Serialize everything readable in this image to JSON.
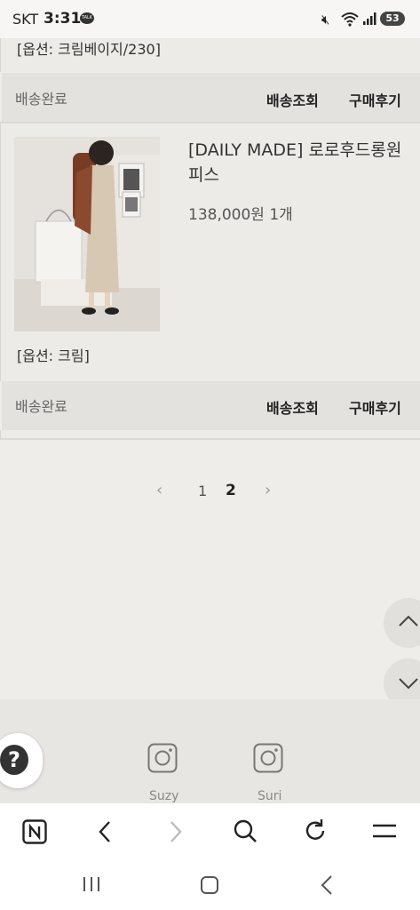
{
  "status_bar": {
    "carrier": "SKT",
    "time": "3:31",
    "talk_badge": "TALK",
    "battery": "53"
  },
  "orders": [
    {
      "option": "[옵션: 크림베이지/230]",
      "ship_status": "배송완료",
      "track_label": "배송조회",
      "review_label": "구매후기"
    },
    {
      "product_name": "[DAILY MADE] 로로후드롱원피스",
      "price_qty": "138,000원 1개",
      "option": "[옵션: 크림]",
      "ship_status": "배송완료",
      "track_label": "배송조회",
      "review_label": "구매후기"
    }
  ],
  "pagination": {
    "prev": "‹",
    "pages": [
      "1",
      "2"
    ],
    "current": "2",
    "next": "›"
  },
  "footer": {
    "help": "?",
    "instagram": [
      {
        "label": "Suzy",
        "icon": "instagram-icon"
      },
      {
        "label": "Suri",
        "icon": "instagram-icon"
      }
    ]
  },
  "browser_toolbar": [
    "naver-home-icon",
    "back-icon",
    "forward-icon",
    "search-icon",
    "refresh-icon",
    "menu-icon"
  ],
  "system_nav": [
    "recents-icon",
    "home-icon",
    "back-icon"
  ]
}
